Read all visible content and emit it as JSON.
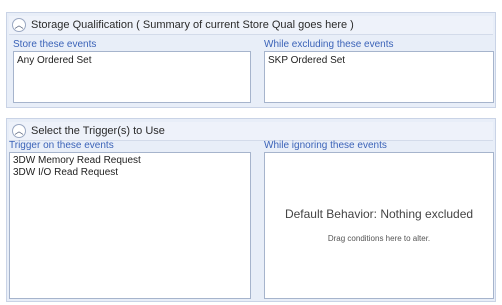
{
  "storage": {
    "header": "Storage Qualification ( Summary of current Store Qual goes here )",
    "store_label": "Store these events",
    "exclude_label": "While excluding these events",
    "store_items": [
      "Any Ordered Set"
    ],
    "exclude_items": [
      "SKP Ordered Set"
    ],
    "collapse_icon": "chevron-up-icon"
  },
  "trigger": {
    "header": "Select the Trigger(s) to Use",
    "trigger_label": "Trigger on these events",
    "ignore_label": "While ignoring these events",
    "trigger_items": [
      "3DW Memory Read Request",
      "3DW I/O Read Request"
    ],
    "ignore_default_title": "Default Behavior: Nothing excluded",
    "ignore_default_hint": "Drag conditions here to alter.",
    "collapse_icon": "chevron-up-icon"
  },
  "colors": {
    "panel_bg": "#e8eef8",
    "label_blue": "#3b63b8"
  }
}
